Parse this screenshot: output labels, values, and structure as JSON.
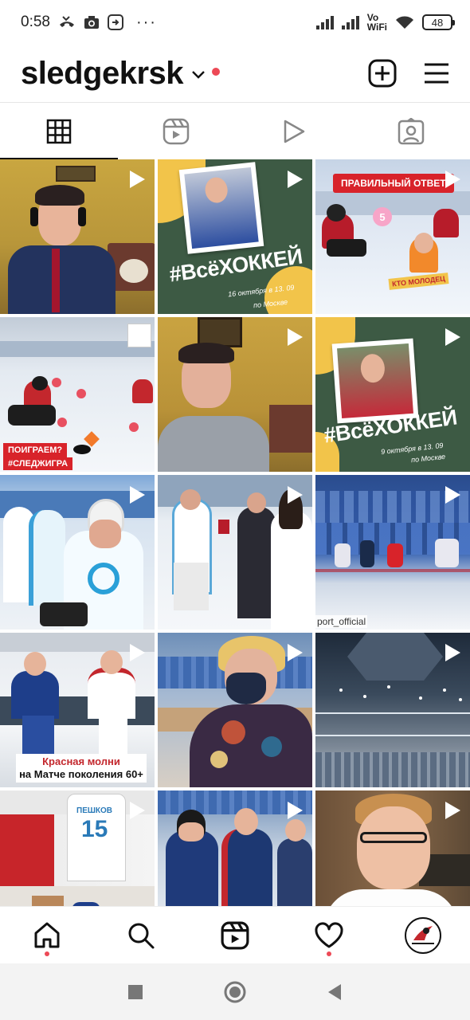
{
  "status_bar": {
    "time": "0:58",
    "network_label": "Vo\nWiFi",
    "network_line1": "Vo",
    "network_line2": "WiFi",
    "battery": "48"
  },
  "header": {
    "username": "sledgekrsk"
  },
  "tabs": [
    {
      "name": "posts-grid"
    },
    {
      "name": "reels"
    },
    {
      "name": "videos"
    },
    {
      "name": "tagged"
    }
  ],
  "posts": {
    "p2": {
      "hashtag": "#ВсёХОККЕЙ",
      "subtitle": "16 октября в 13. 09",
      "city": "по Москве"
    },
    "p3": {
      "tag": "ПРАВИЛЬНЫЙ ОТВЕТ",
      "badge": "КТО МОЛОДЕЦ",
      "number": "5"
    },
    "p4": {
      "tag1": "ПОИГРАЕМ?",
      "tag2": "#СЛЕДЖИГРА"
    },
    "p6": {
      "hashtag": "#ВсёХОККЕЙ",
      "subtitle": "9 октября в 13. 09",
      "city": "по Москве"
    },
    "p9": {
      "watermark": "port_official"
    },
    "p10": {
      "caption_line1": "Красная молни",
      "caption_line2": "на Матче поколения 60+"
    },
    "p13": {
      "jersey_name": "ПЕШКОВ",
      "jersey_number": "15"
    }
  },
  "colors": {
    "accent_red": "#ed4956",
    "poster_green": "#3d5a44",
    "poster_yellow": "#f2c44a"
  }
}
